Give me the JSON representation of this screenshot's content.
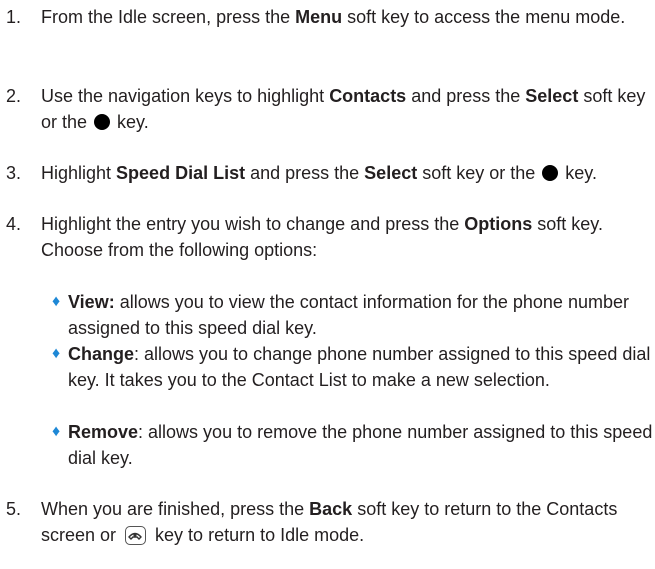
{
  "steps": [
    {
      "num": "1.",
      "parts": [
        "From the Idle screen, press the ",
        "Menu",
        " soft key to access the menu mode."
      ]
    },
    {
      "num": "2.",
      "parts": [
        "Use the navigation keys to highlight ",
        "Contacts",
        " and press the ",
        "Select",
        " soft key or the ",
        " key."
      ]
    },
    {
      "num": "3.",
      "parts": [
        "Highlight ",
        "Speed Dial List",
        " and press the ",
        "Select",
        " soft key or the ",
        " key."
      ]
    },
    {
      "num": "4.",
      "parts": [
        "Highlight the entry you wish to change and press the ",
        "Options",
        " soft key. Choose from the following options:"
      ]
    },
    {
      "num": "5.",
      "parts": [
        "When you are finished, press the ",
        "Back",
        " soft key to return to the Contacts screen or ",
        " key to return to Idle mode."
      ]
    }
  ],
  "options": [
    {
      "label": "View:",
      "text": " allows you to view the contact information for the phone number assigned to this speed dial key."
    },
    {
      "label": "Change",
      "text": ": allows you to change phone number assigned to this speed dial key. It takes you to the Contact List to make a new selection."
    },
    {
      "label": "Remove",
      "text": ": allows you to remove the phone number assigned to this speed dial key."
    }
  ],
  "bullet_glyph": "♦",
  "icons": {
    "select_key": "center-select-key-icon",
    "end_key": "end-key-icon"
  },
  "colors": {
    "text": "#231f20",
    "bullet": "#1e88d6"
  }
}
